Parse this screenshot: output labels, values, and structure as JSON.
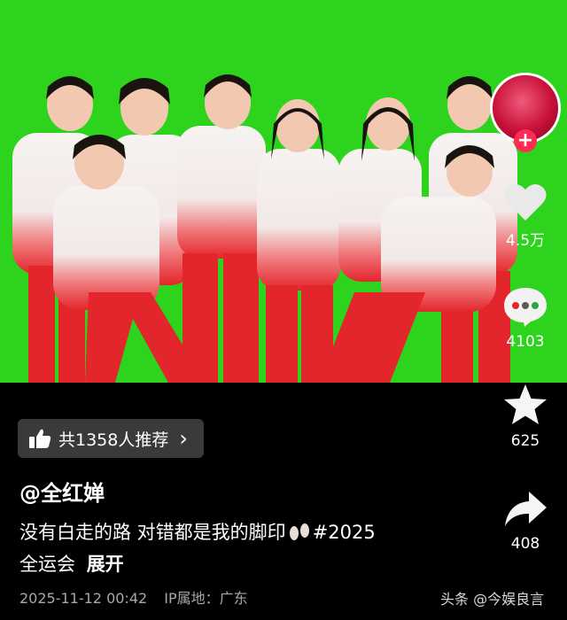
{
  "post": {
    "avatar_icon": "avatar",
    "follow_icon": "plus-icon",
    "follow_glyph": "+",
    "likes": "4.5万",
    "comments": "4103",
    "favorites": "625",
    "shares": "408",
    "recommend_text": "共1358人推荐",
    "recommend_chevron": "›",
    "author": "@全红婵",
    "caption_text": "没有白走的路 对错都是我的脚印",
    "caption_hashtag": "#2025",
    "caption_text2": "全运会",
    "expand_label": "展开",
    "date": "2025-11-12 00:42",
    "ip_location": "IP属地：广东",
    "watermark": "头条 @今娱良言"
  },
  "colors": {
    "background": "#000000",
    "green_screen": "#2ed31d",
    "follow_badge": "#fe2c55",
    "uniform_red": "#e8212b",
    "uniform_white": "#f4f2f0"
  }
}
